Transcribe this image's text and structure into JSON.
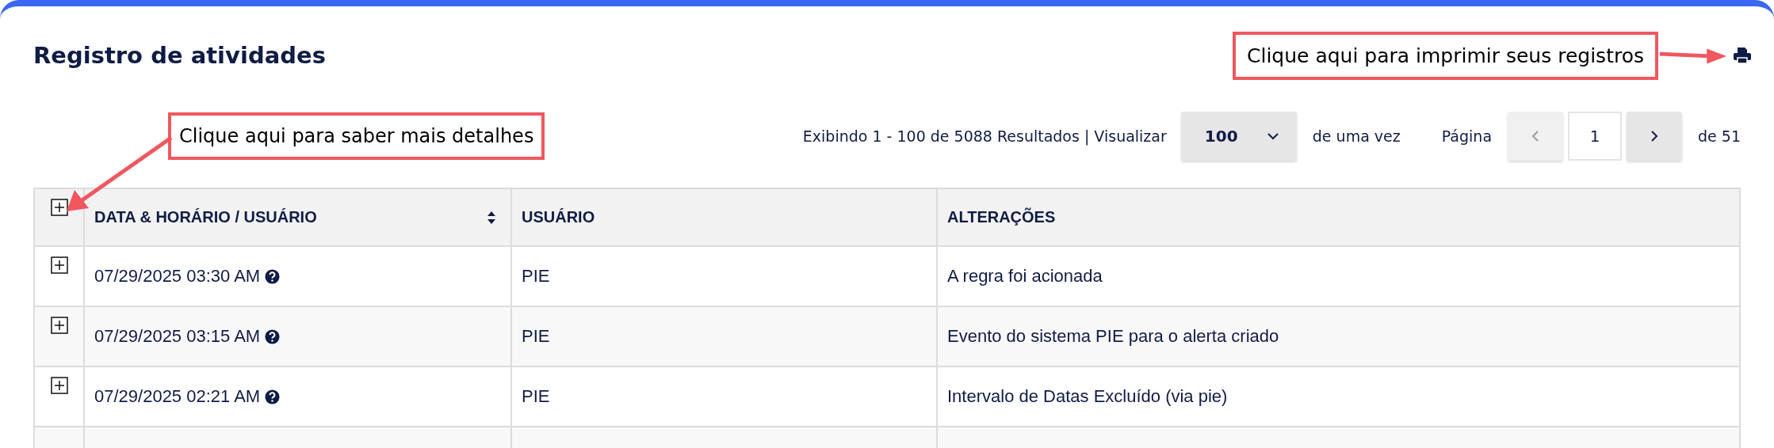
{
  "header": {
    "title": "Registro de atividades"
  },
  "callouts": [
    {
      "kind": "print",
      "text": "Clique aqui para imprimir seus registros"
    },
    {
      "kind": "details",
      "text": "Clique aqui para saber mais detalhes"
    }
  ],
  "pagination": {
    "summary": "Exibindo 1 - 100 de 5088 Resultados | Visualizar",
    "page_size": "100",
    "suffix": "de uma vez",
    "page_label": "Página",
    "page": "1",
    "total": "de 51",
    "prev_disabled": true,
    "next_disabled": false
  },
  "table": {
    "expand_all": {
      "expanded": false
    },
    "columns": [
      {
        "label": "DATA & HORÁRIO / USUÁRIO",
        "sortable": true
      },
      {
        "label": "USUÁRIO",
        "sortable": false
      },
      {
        "label": "ALTERAÇÕES",
        "sortable": false
      }
    ],
    "rows": [
      {
        "expanded": false,
        "datetime": "07/29/2025 03:30 AM",
        "help": true,
        "user": "PIE",
        "change": "A regra foi acionada"
      },
      {
        "expanded": false,
        "datetime": "07/29/2025 03:15 AM",
        "help": true,
        "user": "PIE",
        "change": "Evento do sistema PIE para o alerta criado"
      },
      {
        "expanded": false,
        "datetime": "07/29/2025 02:21 AM",
        "help": true,
        "user": "PIE",
        "change": "Intervalo de Datas Excluído (via pie)"
      }
    ]
  }
}
